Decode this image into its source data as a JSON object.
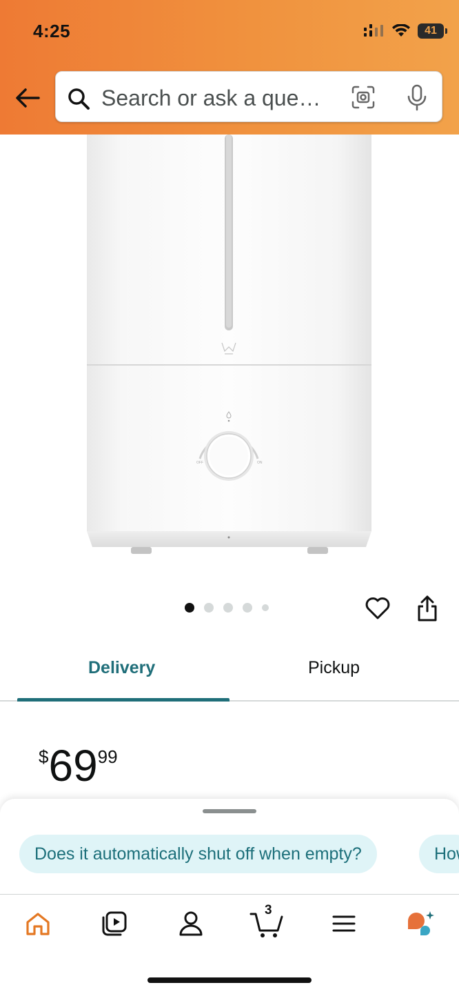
{
  "status_bar": {
    "time": "4:25",
    "battery": "41"
  },
  "search": {
    "placeholder": "Search or ask a que…"
  },
  "carousel": {
    "count": 5,
    "active_index": 0
  },
  "tabs": {
    "delivery": "Delivery",
    "pickup": "Pickup",
    "selected": "Delivery"
  },
  "price": {
    "currency": "$",
    "whole": "69",
    "fraction": "99"
  },
  "suggestions": [
    {
      "label": "Does it automatically shut off when empty?"
    },
    {
      "label": "How"
    }
  ],
  "bottom_nav": {
    "cart_count": "3",
    "items": [
      "home-icon",
      "video-icon",
      "account-icon",
      "cart-icon",
      "menu-icon",
      "rufus-icon"
    ]
  },
  "colors": {
    "header_gradient_start": "#ee7a34",
    "header_gradient_end": "#f2a24a",
    "accent_teal": "#1f6e79",
    "chip_bg": "#dff4f7",
    "home_orange": "#e47823"
  }
}
